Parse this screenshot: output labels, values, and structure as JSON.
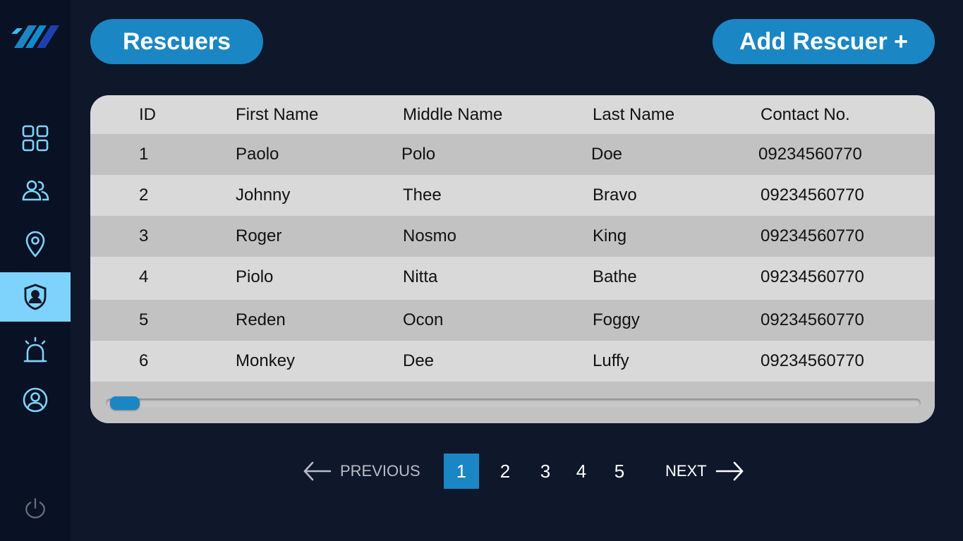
{
  "header": {
    "title": "Rescuers",
    "add_button": "Add Rescuer +"
  },
  "sidebar": {
    "items": [
      {
        "icon": "dashboard-grid-icon"
      },
      {
        "icon": "users-icon"
      },
      {
        "icon": "location-pin-icon"
      },
      {
        "icon": "rescuer-shield-icon",
        "active": true
      },
      {
        "icon": "alarm-siren-icon"
      },
      {
        "icon": "user-profile-icon"
      }
    ],
    "power_icon": "power-icon"
  },
  "table": {
    "columns": [
      "ID",
      "First Name",
      "Middle Name",
      "Last Name",
      "Contact No."
    ],
    "rows": [
      [
        "1",
        "Paolo",
        "Polo",
        "Doe",
        "09234560770"
      ],
      [
        "2",
        "Johnny",
        "Thee",
        "Bravo",
        "09234560770"
      ],
      [
        "3",
        "Roger",
        "Nosmo",
        "King",
        "09234560770"
      ],
      [
        "4",
        "Piolo",
        "Nitta",
        "Bathe",
        "09234560770"
      ],
      [
        "5",
        "Reden",
        "Ocon",
        "Foggy",
        "09234560770"
      ],
      [
        "6",
        "Monkey",
        "Dee",
        "Luffy",
        "09234560770"
      ]
    ]
  },
  "pagination": {
    "previous": "PREVIOUS",
    "next": "NEXT",
    "pages": [
      "1",
      "2",
      "3",
      "4",
      "5"
    ],
    "current": "1"
  },
  "colors": {
    "background": "#0f172b",
    "sidebar": "#091124",
    "accent": "#1b86c4",
    "active_nav": "#7dd3fc",
    "icon": "#7dd3fc"
  }
}
